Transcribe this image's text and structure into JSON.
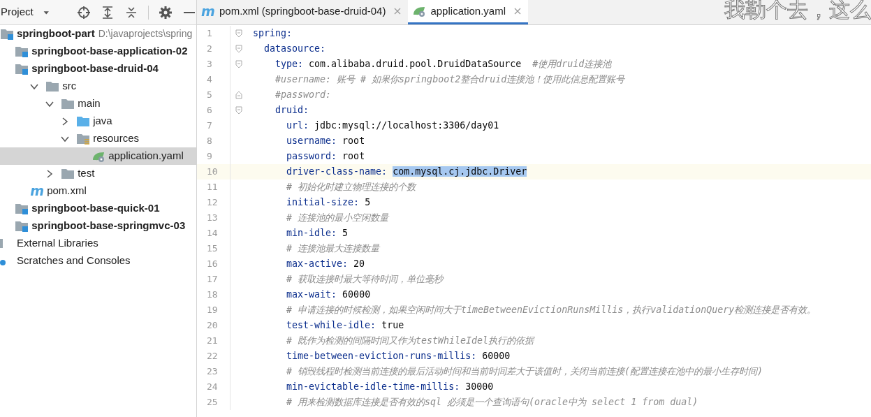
{
  "project_panel": {
    "title": "Project",
    "tree": [
      {
        "label": "springboot-part",
        "path": "D:\\javaprojects\\spring",
        "kind": "module",
        "bold": true,
        "selected": false,
        "children": [
          {
            "label": "springboot-base-application-02",
            "kind": "module",
            "bold": true,
            "selected": false
          },
          {
            "label": "springboot-base-druid-04",
            "kind": "module",
            "bold": true,
            "selected": false,
            "children": [
              {
                "label": "src",
                "kind": "folder",
                "bold": false,
                "selected": false,
                "expanded": true,
                "children": [
                  {
                    "label": "main",
                    "kind": "folder",
                    "bold": false,
                    "selected": false,
                    "expanded": true,
                    "children": [
                      {
                        "label": "java",
                        "kind": "source-folder",
                        "bold": false,
                        "selected": false,
                        "expanded": false
                      },
                      {
                        "label": "resources",
                        "kind": "resource-folder",
                        "bold": false,
                        "selected": false,
                        "expanded": true,
                        "children": [
                          {
                            "label": "application.yaml",
                            "kind": "spring-file",
                            "bold": false,
                            "selected": true
                          }
                        ]
                      }
                    ]
                  },
                  {
                    "label": "test",
                    "kind": "folder",
                    "bold": false,
                    "selected": false,
                    "expanded": false
                  }
                ]
              },
              {
                "label": "pom.xml",
                "kind": "maven",
                "icon_text": "m",
                "bold": false,
                "selected": false
              }
            ]
          },
          {
            "label": "springboot-base-quick-01",
            "kind": "module",
            "bold": true,
            "selected": false
          },
          {
            "label": "springboot-base-springmvc-03",
            "kind": "module",
            "bold": true,
            "selected": false
          }
        ]
      },
      {
        "label": "External Libraries",
        "kind": "library",
        "bold": false,
        "selected": false
      },
      {
        "label": "Scratches and Consoles",
        "kind": "scratch",
        "bold": false,
        "selected": false
      }
    ]
  },
  "tabs": [
    {
      "label": "pom.xml (springboot-base-druid-04)",
      "kind": "maven",
      "icon_text": "m",
      "selected": false
    },
    {
      "label": "application.yaml",
      "kind": "spring-file",
      "selected": true
    }
  ],
  "subtitle": "我勒个去，这么",
  "editor": {
    "lines": [
      {
        "number": "1",
        "kind": "key",
        "key": "spring:",
        "current": false,
        "value_selected": false
      },
      {
        "number": "2",
        "kind": "key",
        "key": "  datasource:",
        "current": false,
        "value_selected": false
      },
      {
        "number": "3",
        "kind": "pair",
        "key": "    type:",
        "value": "com.alibaba.druid.pool.DruidDataSource",
        "comment": "#使用druid连接池",
        "current": false,
        "value_selected": false
      },
      {
        "number": "4",
        "kind": "comment",
        "text": "    #username: 账号 # 如果你springboot2整合druid连接池！使用此信息配置账号",
        "current": false,
        "value_selected": false
      },
      {
        "number": "5",
        "kind": "comment",
        "text": "    #password:",
        "current": false,
        "value_selected": false
      },
      {
        "number": "6",
        "kind": "key",
        "key": "    druid:",
        "current": false,
        "value_selected": false
      },
      {
        "number": "7",
        "kind": "pair",
        "key": "      url:",
        "value": "jdbc:mysql://localhost:3306/day01",
        "current": false,
        "value_selected": false
      },
      {
        "number": "8",
        "kind": "pair",
        "key": "      username:",
        "value": "root",
        "current": false,
        "value_selected": false
      },
      {
        "number": "9",
        "kind": "pair",
        "key": "      password:",
        "value": "root",
        "current": false,
        "value_selected": false
      },
      {
        "number": "10",
        "kind": "pair",
        "key": "      driver-class-name:",
        "value": "com.mysql.cj.jdbc.Driver",
        "current": true,
        "value_selected": true
      },
      {
        "number": "11",
        "kind": "comment",
        "text": "      # 初始化时建立物理连接的个数",
        "current": false,
        "value_selected": false
      },
      {
        "number": "12",
        "kind": "pair",
        "key": "      initial-size:",
        "value": "5",
        "current": false,
        "value_selected": false
      },
      {
        "number": "13",
        "kind": "comment",
        "text": "      # 连接池的最小空闲数量",
        "current": false,
        "value_selected": false
      },
      {
        "number": "14",
        "kind": "pair",
        "key": "      min-idle:",
        "value": "5",
        "current": false,
        "value_selected": false
      },
      {
        "number": "15",
        "kind": "comment",
        "text": "      # 连接池最大连接数量",
        "current": false,
        "value_selected": false
      },
      {
        "number": "16",
        "kind": "pair",
        "key": "      max-active:",
        "value": "20",
        "current": false,
        "value_selected": false
      },
      {
        "number": "17",
        "kind": "comment",
        "text": "      # 获取连接时最大等待时间，单位毫秒",
        "current": false,
        "value_selected": false
      },
      {
        "number": "18",
        "kind": "pair",
        "key": "      max-wait:",
        "value": "60000",
        "current": false,
        "value_selected": false
      },
      {
        "number": "19",
        "kind": "comment",
        "text": "      # 申请连接的时候检测，如果空闲时间大于timeBetweenEvictionRunsMillis，执行validationQuery检测连接是否有效。",
        "current": false,
        "value_selected": false
      },
      {
        "number": "20",
        "kind": "pair",
        "key": "      test-while-idle:",
        "value": "true",
        "current": false,
        "value_selected": false
      },
      {
        "number": "21",
        "kind": "comment",
        "text": "      # 既作为检测的间隔时间又作为testWhileIdel执行的依据",
        "current": false,
        "value_selected": false
      },
      {
        "number": "22",
        "kind": "pair",
        "key": "      time-between-eviction-runs-millis:",
        "value": "60000",
        "current": false,
        "value_selected": false
      },
      {
        "number": "23",
        "kind": "comment",
        "text": "      # 销毁线程时检测当前连接的最后活动时间和当前时间差大于该值时，关闭当前连接(配置连接在池中的最小生存时间)",
        "current": false,
        "value_selected": false
      },
      {
        "number": "24",
        "kind": "pair",
        "key": "      min-evictable-idle-time-millis:",
        "value": "30000",
        "current": false,
        "value_selected": false
      },
      {
        "number": "25",
        "kind": "comment",
        "text": "      # 用来检测数据库连接是否有效的sql 必须是一个查询语句(oracle中为 select 1 from dual)",
        "current": false,
        "value_selected": false
      }
    ]
  }
}
